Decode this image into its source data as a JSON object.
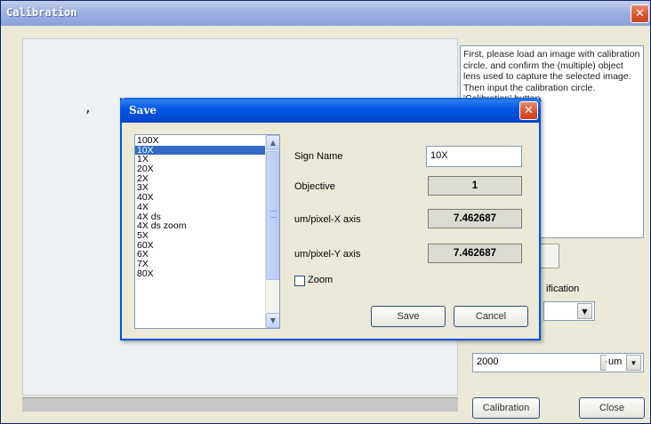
{
  "main_window": {
    "title": "Calibration",
    "close_glyph": "✕",
    "info_text": "First, please load an image with calibration circle, and confirm the (multiple) object lens used to capture the selected image.  Then input the calibration circle. 'Calibration' button.",
    "magnification_label_fragment": "ification",
    "circle_size": "2000",
    "unit": "um",
    "calibration_button": "Calibration",
    "close_button": "Close",
    "dropdown_glyph": "▼"
  },
  "save_dialog": {
    "title": "Save",
    "close_glyph": "✕",
    "list_items": [
      "100X",
      "10X",
      "1X",
      "20X",
      "2X",
      "3X",
      "40X",
      "4X",
      "4X ds",
      "4X ds zoom",
      "5X",
      "60X",
      "6X",
      "7X",
      "80X"
    ],
    "selected_index": 1,
    "sign_name_label": "Sign Name",
    "sign_name_value": "10X",
    "objective_label": "Objective",
    "objective_value": "1",
    "x_axis_label": "um/pixel-X axis",
    "x_axis_value": "7.462687",
    "y_axis_label": "um/pixel-Y axis",
    "y_axis_value": "7.462687",
    "zoom_label": "Zoom",
    "save_button": "Save",
    "cancel_button": "Cancel",
    "scroll_up_glyph": "▲",
    "scroll_down_glyph": "▼"
  },
  "colors": {
    "dialog_title_bar": "#0055e5",
    "list_selection": "#316ac5",
    "main_title_bar": "#9fb4e2"
  }
}
